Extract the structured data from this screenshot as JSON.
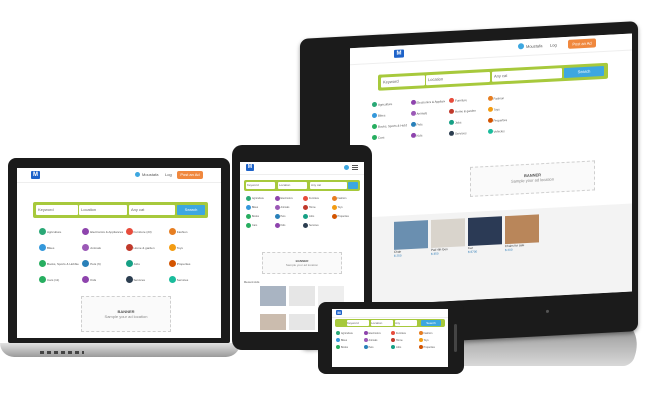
{
  "brand": {
    "logo_text": "M"
  },
  "colors": {
    "green": "#a7c93c",
    "orange": "#f0883e",
    "blue": "#3da7e0",
    "logo": "#1e63c9"
  },
  "monitor": {
    "header": {
      "user": "Moustafa",
      "login": "Log",
      "post": "Post an Ad"
    },
    "search": {
      "keyword": "Keyword",
      "location": "Location",
      "category": "Any cat",
      "button": "Search"
    },
    "categories": [
      {
        "label": "Agriculture",
        "color": "#2aa876"
      },
      {
        "label": "Electronics & Appliances",
        "color": "#8e44ad"
      },
      {
        "label": "Furniture",
        "color": "#e74c3c"
      },
      {
        "label": "Fashion",
        "color": "#e67e22"
      },
      {
        "label": "Bikes",
        "color": "#3498db"
      },
      {
        "label": "Animals",
        "color": "#9b59b6"
      },
      {
        "label": "Home & garden",
        "color": "#c0392b"
      },
      {
        "label": "Toys",
        "color": "#f39c12"
      },
      {
        "label": "Books, Sports & Hobbies",
        "color": "#27ae60"
      },
      {
        "label": "Pets",
        "color": "#2980b9"
      },
      {
        "label": "Jobs",
        "color": "#16a085"
      },
      {
        "label": "Properties",
        "color": "#d35400"
      },
      {
        "label": "Cars",
        "color": "#27ae60"
      },
      {
        "label": "Kids",
        "color": "#8e44ad"
      },
      {
        "label": "Services",
        "color": "#2c3e50"
      },
      {
        "label": "Vehicles",
        "color": "#1abc9c"
      }
    ],
    "banner": {
      "title": "BANNER",
      "subtitle": "Sample your ad location"
    },
    "listings": [
      {
        "caption": "Chair",
        "price": "$ 250",
        "bg": "#6a8fb0"
      },
      {
        "caption": "Pad 4th Gen",
        "price": "$ 350",
        "bg": "#d9d4cc"
      },
      {
        "caption": "Car",
        "price": "$ 8700",
        "bg": "#2b3a55"
      },
      {
        "caption": "Chairs for sale",
        "price": "$ 200",
        "bg": "#b9865a"
      }
    ]
  },
  "laptop": {
    "header": {
      "user": "Moustafa",
      "login": "Log",
      "post": "Post an Ad"
    },
    "search": {
      "keyword": "Keyword",
      "location": "Location",
      "category": "Any cat",
      "button": "Search"
    },
    "categories": [
      {
        "label": "Agriculture",
        "color": "#2aa876"
      },
      {
        "label": "Electronics & Appliances (12)",
        "color": "#8e44ad"
      },
      {
        "label": "Furniture (23)",
        "color": "#e74c3c"
      },
      {
        "label": "Fashion",
        "color": "#e67e22"
      },
      {
        "label": "Bikes",
        "color": "#3498db"
      },
      {
        "label": "Animals",
        "color": "#9b59b6"
      },
      {
        "label": "Home & garden",
        "color": "#c0392b"
      },
      {
        "label": "Toys",
        "color": "#f39c12"
      },
      {
        "label": "Books, Sports & Hobbies",
        "color": "#27ae60"
      },
      {
        "label": "Pets (6)",
        "color": "#2980b9"
      },
      {
        "label": "Jobs",
        "color": "#16a085"
      },
      {
        "label": "Properties",
        "color": "#d35400"
      },
      {
        "label": "Cars (11)",
        "color": "#27ae60"
      },
      {
        "label": "Kids",
        "color": "#8e44ad"
      },
      {
        "label": "Services",
        "color": "#2c3e50"
      },
      {
        "label": "Services",
        "color": "#1abc9c"
      }
    ],
    "banner": {
      "title": "BANNER",
      "subtitle": "Sample your ad location"
    }
  },
  "tablet": {
    "search": {
      "keyword": "Keyword",
      "location": "Location",
      "category": "Any cat"
    },
    "categories": [
      {
        "label": "Agriculture",
        "color": "#2aa876"
      },
      {
        "label": "Electronics",
        "color": "#8e44ad"
      },
      {
        "label": "Furniture",
        "color": "#e74c3c"
      },
      {
        "label": "Fashion",
        "color": "#e67e22"
      },
      {
        "label": "Bikes",
        "color": "#3498db"
      },
      {
        "label": "Animals",
        "color": "#9b59b6"
      },
      {
        "label": "Home",
        "color": "#c0392b"
      },
      {
        "label": "Toys",
        "color": "#f39c12"
      },
      {
        "label": "Books",
        "color": "#27ae60"
      },
      {
        "label": "Pets",
        "color": "#2980b9"
      },
      {
        "label": "Jobs",
        "color": "#16a085"
      },
      {
        "label": "Properties",
        "color": "#d35400"
      },
      {
        "label": "Cars",
        "color": "#27ae60"
      },
      {
        "label": "Kids",
        "color": "#8e44ad"
      },
      {
        "label": "Services",
        "color": "#2c3e50"
      }
    ],
    "banner": {
      "title": "BANNER",
      "subtitle": "Sample your ad location"
    },
    "section_label": "Recent Ads"
  },
  "phone": {
    "search": {
      "keyword": "Keyword",
      "location": "Location",
      "category": "Any",
      "button": "Search"
    },
    "categories": [
      {
        "label": "Agriculture",
        "color": "#2aa876"
      },
      {
        "label": "Electronics",
        "color": "#8e44ad"
      },
      {
        "label": "Furniture",
        "color": "#e74c3c"
      },
      {
        "label": "Fashion",
        "color": "#e67e22"
      },
      {
        "label": "Bikes",
        "color": "#3498db"
      },
      {
        "label": "Animals",
        "color": "#9b59b6"
      },
      {
        "label": "Home",
        "color": "#c0392b"
      },
      {
        "label": "Toys",
        "color": "#f39c12"
      },
      {
        "label": "Books",
        "color": "#27ae60"
      },
      {
        "label": "Pets",
        "color": "#2980b9"
      },
      {
        "label": "Jobs",
        "color": "#16a085"
      },
      {
        "label": "Properties",
        "color": "#d35400"
      }
    ]
  }
}
